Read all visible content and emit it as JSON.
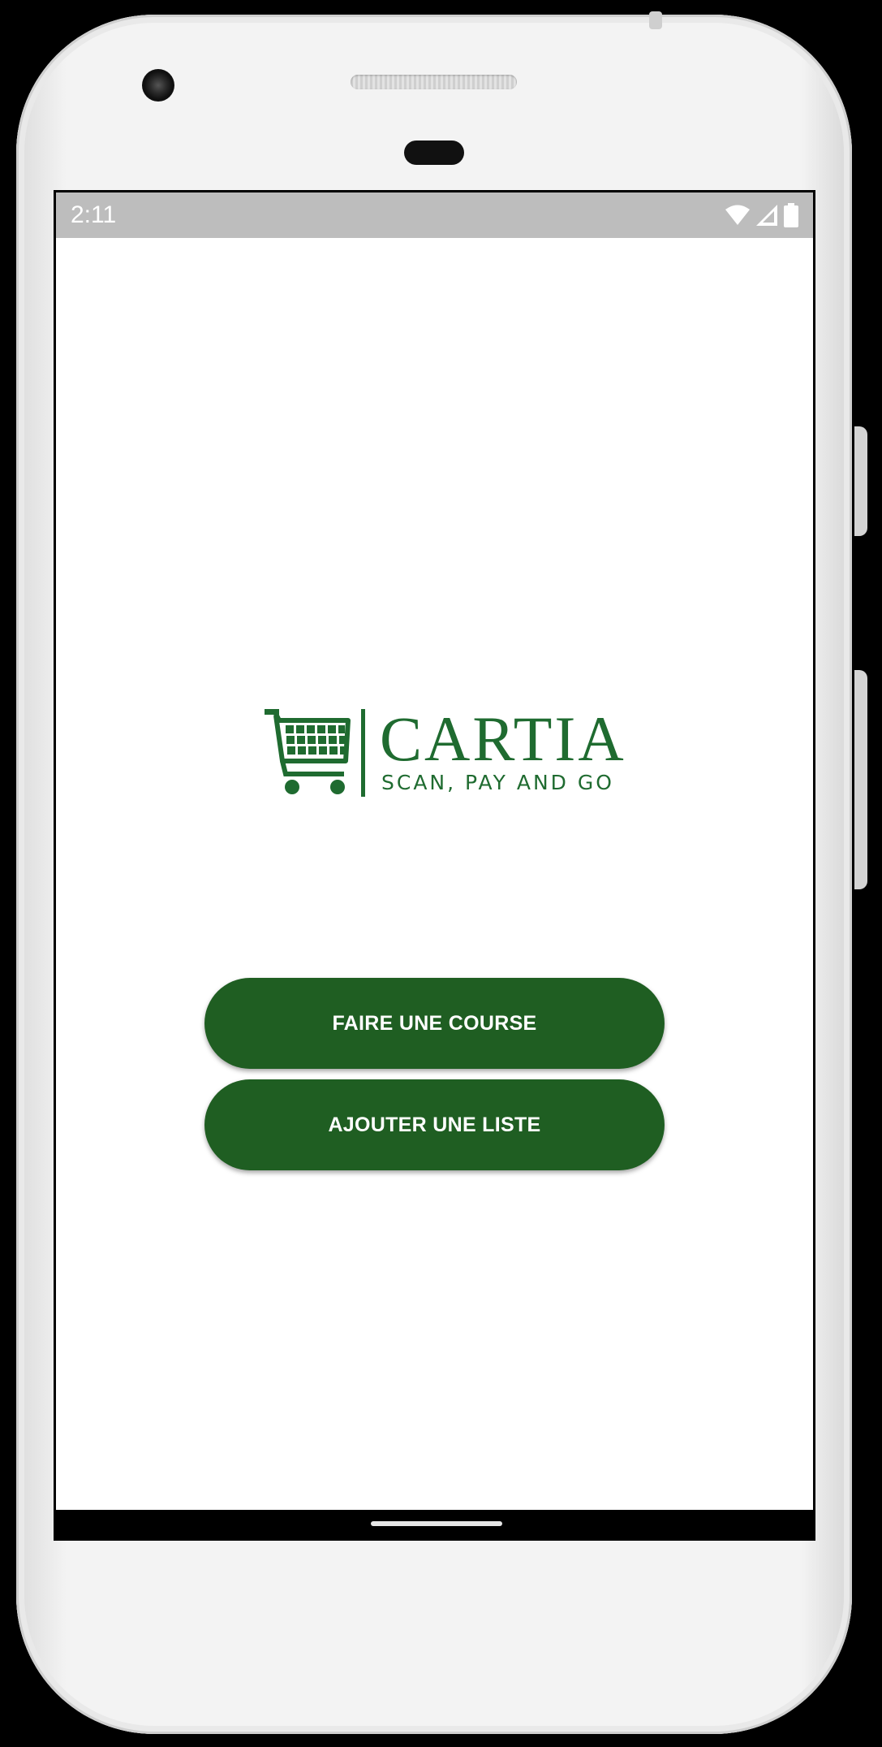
{
  "status_bar": {
    "time": "2:11",
    "icons": [
      "wifi-icon",
      "cellular-signal-icon",
      "battery-icon"
    ]
  },
  "logo": {
    "title": "CARTIA",
    "tagline": "SCAN, PAY AND GO",
    "icon": "shopping-cart-icon"
  },
  "actions": {
    "primary_label": "FAIRE UNE COURSE",
    "secondary_label": "AJOUTER UNE LISTE"
  },
  "colors": {
    "brand_green": "#1f6b30",
    "button_green": "#1f5e22",
    "status_bar": "#bdbdbd",
    "background": "#ffffff"
  }
}
